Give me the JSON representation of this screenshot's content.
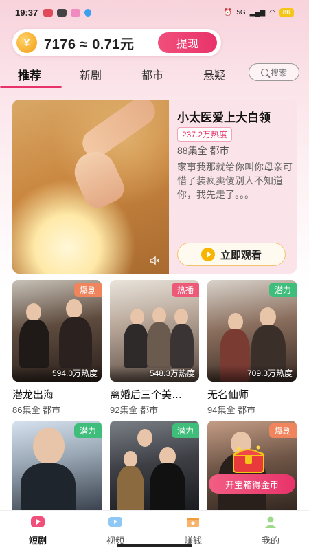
{
  "status_bar": {
    "time": "19:37",
    "network": "5G",
    "battery": "86"
  },
  "coin_bar": {
    "coin_symbol": "¥",
    "balance_text": "7176 ≈ 0.71元",
    "withdraw_label": "提现"
  },
  "tabs": [
    {
      "label": "推荐",
      "active": true
    },
    {
      "label": "新剧",
      "active": false
    },
    {
      "label": "都市",
      "active": false
    },
    {
      "label": "悬疑",
      "active": false
    }
  ],
  "search": {
    "placeholder": "搜索"
  },
  "featured": {
    "title": "小太医爱上大白领",
    "heat": "237.2万热度",
    "meta": "88集全 都市",
    "description": "家事我那就给你叫你母亲可惜了装疯卖傻别人不知道你，我先走了。。。",
    "watch_label": "立即观看",
    "icons": {
      "mute": "mute-icon",
      "play": "play-icon"
    }
  },
  "cards": [
    {
      "title": "潜龙出海",
      "meta": "86集全 都市",
      "badge": "爆剧",
      "badge_type": "hot",
      "heat": "594.0万热度"
    },
    {
      "title": "离婚后三个美…",
      "meta": "92集全 都市",
      "badge": "热播",
      "badge_type": "live",
      "heat": "548.3万热度"
    },
    {
      "title": "无名仙师",
      "meta": "94集全 都市",
      "badge": "潜力",
      "badge_type": "pot",
      "heat": "709.3万热度"
    },
    {
      "badge": "潜力",
      "badge_type": "pot"
    },
    {
      "badge": "潜力",
      "badge_type": "pot"
    },
    {
      "badge": "爆剧",
      "badge_type": "hot"
    }
  ],
  "promo": {
    "label": "开宝箱得金币"
  },
  "bottom_nav": [
    {
      "label": "短剧",
      "icon": "drama-icon",
      "active": true
    },
    {
      "label": "视频",
      "icon": "video-icon",
      "active": false
    },
    {
      "label": "赚钱",
      "icon": "wallet-icon",
      "active": false
    },
    {
      "label": "我的",
      "icon": "profile-icon",
      "active": false
    }
  ],
  "colors": {
    "accent": "#e8336a",
    "badge_hot": "#f0845c",
    "badge_live": "#ec5a78",
    "badge_potential": "#3fbd7b",
    "watch_border": "#f5c26b"
  }
}
